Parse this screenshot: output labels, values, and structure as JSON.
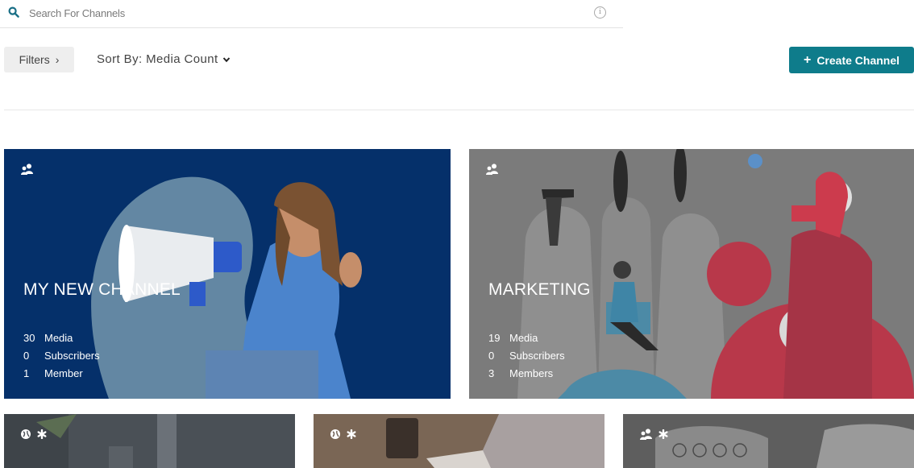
{
  "search": {
    "placeholder": "Search For Channels",
    "info_glyph": "i"
  },
  "toolbar": {
    "filters_label": "Filters",
    "filters_chevron": "›",
    "sort_label": "Sort By: Media Count",
    "create_plus": "+",
    "create_label": "Create Channel"
  },
  "colors": {
    "accent": "#0e7c8b",
    "card_blue": "#05306a",
    "card_grey": "#7b7b7b",
    "card_red": "#b8384a"
  },
  "channels": [
    {
      "title": "MY NEW CHANNEL",
      "icons": [
        "group-icon"
      ],
      "stats": [
        {
          "num": "30",
          "label": "Media"
        },
        {
          "num": "0",
          "label": "Subscribers"
        },
        {
          "num": "1",
          "label": "Member"
        }
      ]
    },
    {
      "title": "MARKETING",
      "icons": [
        "group-icon"
      ],
      "stats": [
        {
          "num": "19",
          "label": "Media"
        },
        {
          "num": "0",
          "label": "Subscribers"
        },
        {
          "num": "3",
          "label": "Members"
        }
      ]
    },
    {
      "icons": [
        "globe-icon",
        "asterisk-icon"
      ]
    },
    {
      "icons": [
        "globe-icon",
        "asterisk-icon"
      ]
    },
    {
      "icons": [
        "group-icon",
        "asterisk-icon"
      ]
    }
  ]
}
